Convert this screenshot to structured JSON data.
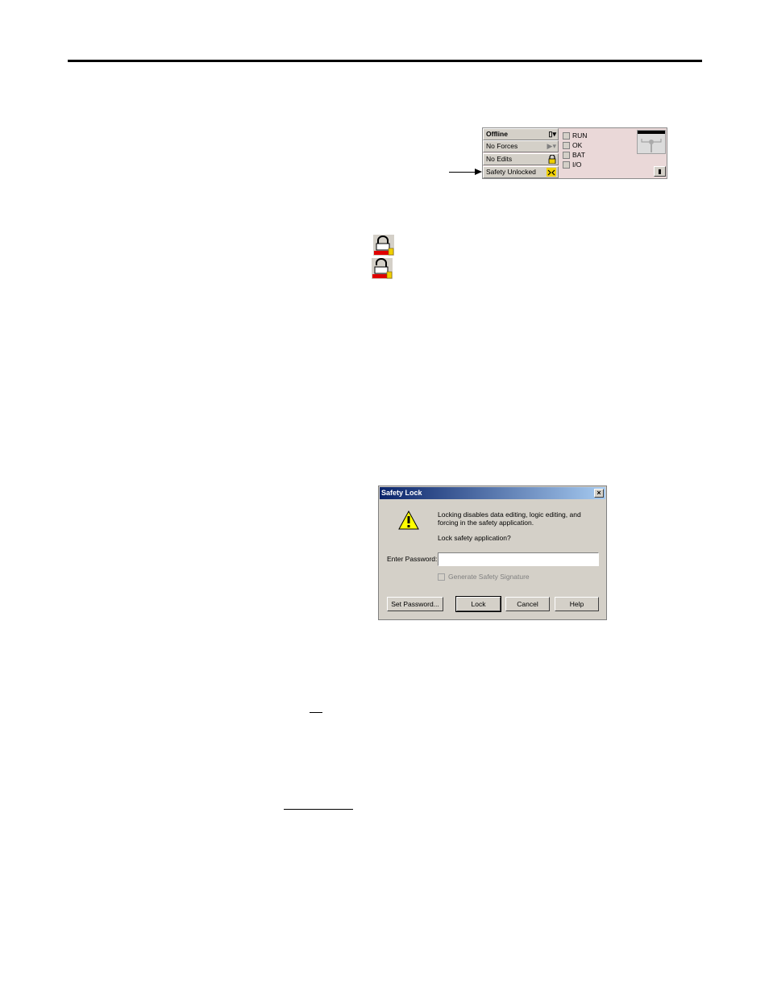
{
  "status_toolbar": {
    "rows": [
      {
        "label": "Offline",
        "icon": "key-dropdown-icon"
      },
      {
        "label": "No Forces",
        "icon": "play-dropdown-icon"
      },
      {
        "label": "No Edits",
        "icon": "edit-lock-icon"
      },
      {
        "label": "Safety Unlocked",
        "icon": "safety-unlocked-icon"
      }
    ],
    "leds": [
      "RUN",
      "OK",
      "BAT",
      "I/O"
    ]
  },
  "legend_icons": [
    "safety-locked-icon",
    "safety-unlocked-icon"
  ],
  "dialog": {
    "title": "Safety Lock",
    "message_line1": "Locking disables data editing, logic editing, and",
    "message_line2": "forcing in the safety application.",
    "question": "Lock safety application?",
    "password_label": "Enter Password:",
    "password_value": "",
    "signature_checkbox": "Generate Safety Signature",
    "buttons": {
      "set_password": "Set Password...",
      "lock": "Lock",
      "cancel": "Cancel",
      "help": "Help"
    }
  },
  "colors": {
    "title_gradient_start": "#0a246a",
    "title_gradient_end": "#a6caf0",
    "toolbar_background": "#ead8d8",
    "lock_red": "#e00000",
    "lock_yellow": "#f0d000"
  }
}
